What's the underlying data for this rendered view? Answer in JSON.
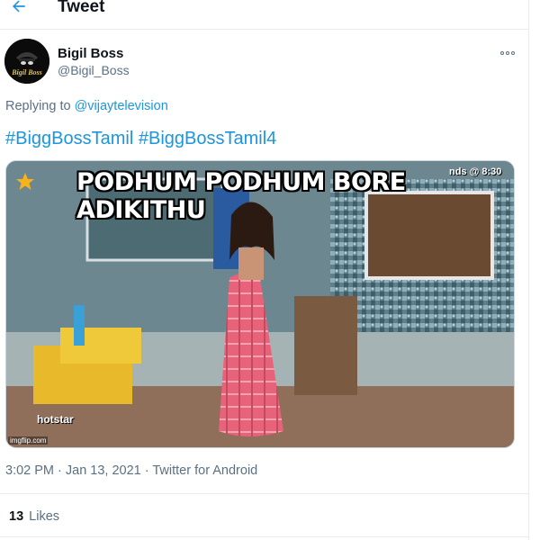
{
  "header": {
    "title": "Tweet"
  },
  "author": {
    "name": "Bigil Boss",
    "handle": "@Bigil_Boss",
    "avatar_text": "Bigil Boss"
  },
  "reply": {
    "prefix": "Replying to ",
    "to": "@vijaytelevision"
  },
  "tweet": {
    "hashtags": [
      "#BiggBossTamil",
      "#BiggBossTamil4"
    ]
  },
  "media": {
    "caption": "PODHUM PODHUM BORE ADIKITHU",
    "timestamp_overlay": "nds @ 8:30",
    "watermark": "hotstar",
    "corner_mark": "imgflip.com"
  },
  "meta": {
    "time": "3:02 PM",
    "sep1": " · ",
    "date": "Jan 13, 2021",
    "sep2": " · ",
    "source": "Twitter for Android"
  },
  "likes": {
    "count": "13",
    "label": "Likes"
  },
  "colors": {
    "accent": "#1b95e0",
    "muted": "#5b7083",
    "text": "#0f1419",
    "border": "#e6ecf0"
  },
  "icons": {
    "back": "back-arrow-icon",
    "more": "more-icon"
  }
}
